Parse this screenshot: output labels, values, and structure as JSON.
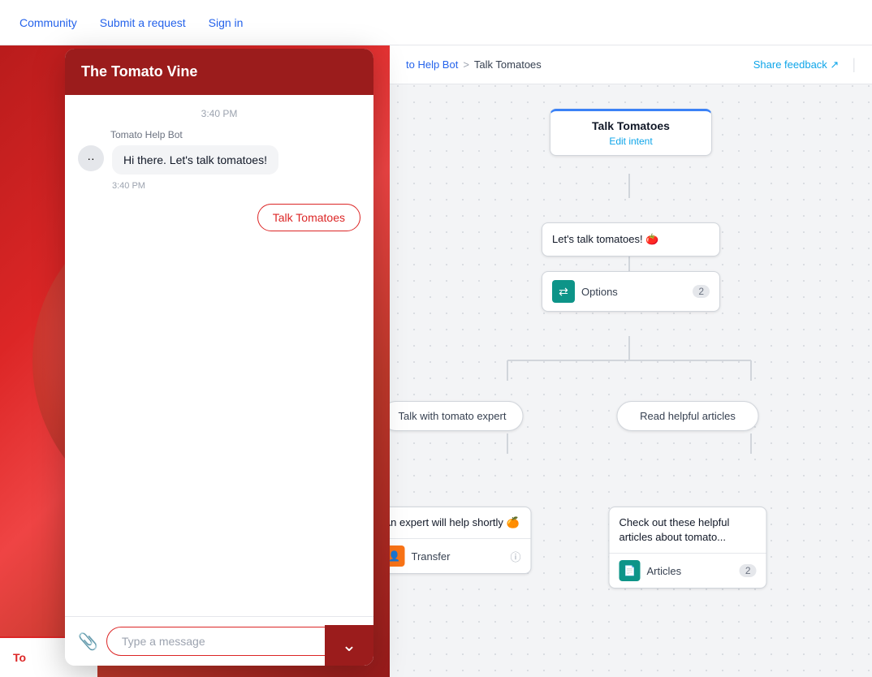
{
  "nav": {
    "links": [
      "Community",
      "Submit a request",
      "Sign in"
    ]
  },
  "topbar": {
    "share_feedback": "Share feedback ↗",
    "breadcrumb_link": "to Help Bot",
    "breadcrumb_sep": ">",
    "breadcrumb_current": "Talk Tomatoes"
  },
  "flow": {
    "start_node": {
      "title": "Talk Tomatoes",
      "edit_link": "Edit intent"
    },
    "message_node": {
      "text": "Let's talk tomatoes! 🍅"
    },
    "options_node": {
      "label": "Options",
      "count": "2"
    },
    "branch_left": "Talk with tomato expert",
    "branch_right": "Read helpful articles",
    "result_left": {
      "text": "An expert will help shortly 🍊",
      "footer_label": "Transfer",
      "icon_type": "transfer"
    },
    "result_right": {
      "text": "Check out these helpful articles about tomato...",
      "footer_label": "Articles",
      "count": "2",
      "icon_type": "articles"
    }
  },
  "chat": {
    "header_title": "The Tomato Vine",
    "timestamp": "3:40 PM",
    "bot_name": "Tomato Help Bot",
    "bot_message": "Hi there. Let's talk tomatoes!",
    "bot_time": "3:40 PM",
    "user_response": "Talk Tomatoes",
    "input_placeholder": "Type a message",
    "footer_icon": "⌄"
  },
  "red_tab_text": "To"
}
